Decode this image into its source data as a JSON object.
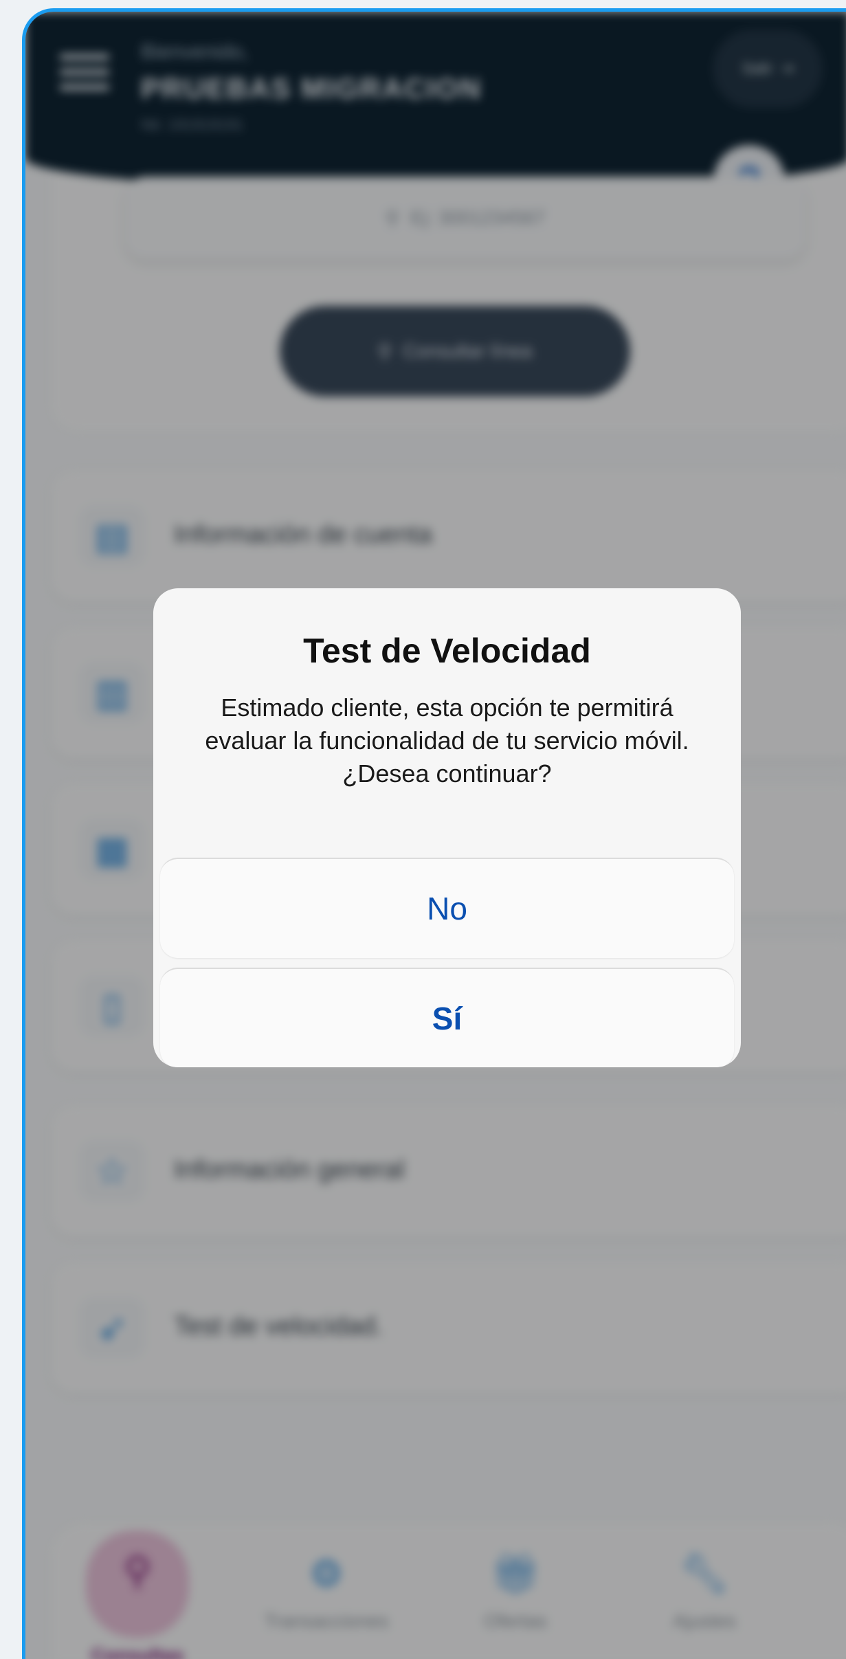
{
  "header": {
    "greeting": "Bienvenido,",
    "user_name": "PRUEBAS MIGRACION",
    "nit": "Nit: 191919191",
    "exit_label": "Salir",
    "help_icon": "help-icon"
  },
  "search": {
    "placeholder": "Ej: 3001234567",
    "button_label": "Consultar línea"
  },
  "menu": {
    "items": [
      {
        "label": "Información de cuenta",
        "icon": "account-card-icon"
      },
      {
        "label": "",
        "icon": "plan-card-icon"
      },
      {
        "label": "",
        "icon": "line-card-icon"
      },
      {
        "label": "",
        "icon": "device-icon"
      },
      {
        "label": "Información general",
        "icon": "star-icon"
      },
      {
        "label": "Test de velocidad.",
        "icon": "rocket-icon"
      }
    ]
  },
  "tabs": [
    {
      "label": "Consultas",
      "icon": "search-icon",
      "active": true
    },
    {
      "label": "Transacciones",
      "icon": "gear-icon",
      "active": false
    },
    {
      "label": "Ofertas",
      "icon": "gift-icon",
      "active": false
    },
    {
      "label": "Ajustes",
      "icon": "wrench-icon",
      "active": false
    }
  ],
  "dialog": {
    "title": "Test de Velocidad",
    "message": "Estimado cliente, esta opción te permitirá evaluar la funcionalidad de tu servicio móvil. ¿Desea continuar?",
    "no_label": "No",
    "yes_label": "Sí"
  },
  "colors": {
    "header_bg": "#0f2433",
    "accent_blue": "#2e8ad6",
    "active_tab": "#7a1a74",
    "dialog_button_text": "#0a4fb0",
    "frame_border": "#1a9cf0"
  }
}
